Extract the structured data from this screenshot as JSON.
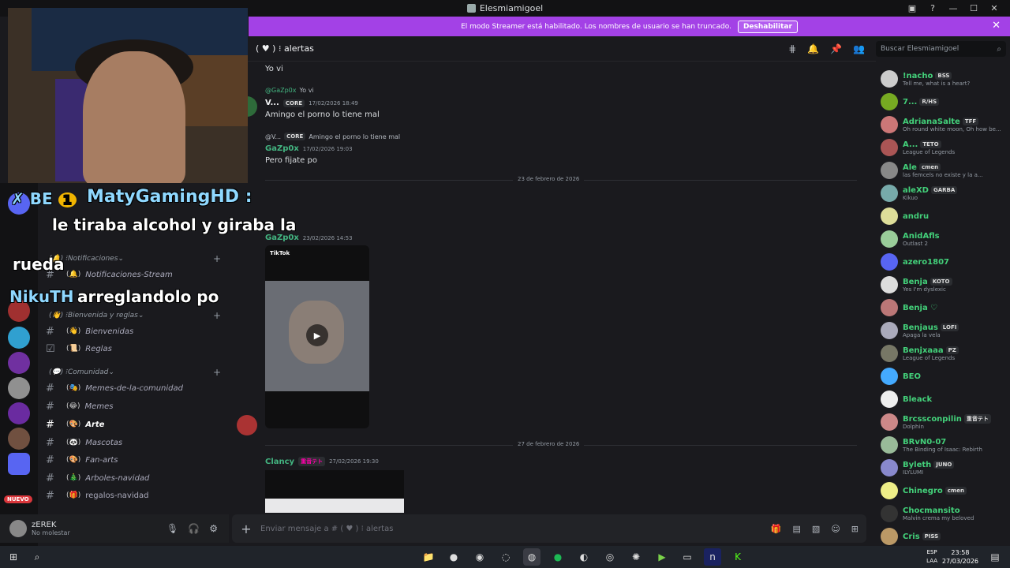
{
  "window": {
    "title": "Elesmiamigoel"
  },
  "banner": {
    "text": "El modo Streamer está habilitado. Los nombres de usuario se han truncado.",
    "button": "Deshabilitar"
  },
  "channel": {
    "name": "alertas",
    "emoji": "♥"
  },
  "search": {
    "placeholder": "Buscar Elesmiamigoel"
  },
  "messages": {
    "m0": "Yo vi",
    "r1_user": "@GaZp0x",
    "r1_text": "Yo vi",
    "a1_name": "V...",
    "a1_tag": "CORE",
    "a1_ts": "17/02/2026 18:49",
    "a1_text": "Amingo el porno lo tiene mal",
    "r2_user": "@V...",
    "r2_tag": "CORE",
    "r2_text": "Amingo el porno lo tiene mal",
    "a2_name": "GaZp0x",
    "a2_ts": "17/02/2026 19:03",
    "a2_text": "Pero fijate po",
    "div1": "23 de febrero de 2026",
    "a3_name": "GaZp0x",
    "a3_ts": "23/02/2026 14:53",
    "tiktok": "TikTok",
    "div2": "27 de febrero de 2026",
    "a4_name": "Clancy",
    "a4_tag": "重音テト",
    "a4_ts": "27/02/2026 19:30"
  },
  "composer": {
    "placeholder": "Enviar mensaje a #  (  ♥  )  ⁝ alertas"
  },
  "sidebar": {
    "cat_notif": "Notificaciones",
    "ch_notif_stream": "Notificaciones-Stream",
    "cat_bienvenida": "Bienvenida y reglas",
    "ch_bienvenidas": "Bienvenidas",
    "ch_reglas": "Reglas",
    "cat_comunidad": "Comunidad",
    "ch_memes_com": "Memes-de-la-comunidad",
    "ch_memes": "Memes",
    "ch_arte": "Arte",
    "ch_mascotas": "Mascotas",
    "ch_fanarts": "Fan-arts",
    "ch_arboles": "Arboles-navidad",
    "ch_regalos": "regalos-navidad",
    "nuevo": "NUEVO"
  },
  "user": {
    "name": "zEREK",
    "status": "No molestar"
  },
  "members": [
    {
      "name": "!nacho",
      "tag": "BSS",
      "sub": "Tell me, what is a heart?",
      "color": "#43d17a"
    },
    {
      "name": "7...",
      "tag": "R/HS",
      "sub": "",
      "color": "#43d17a"
    },
    {
      "name": "AdrianaSalte",
      "tag": "TFF",
      "sub": "Oh round white moon, Oh how be...",
      "color": "#43d17a"
    },
    {
      "name": "A...",
      "tag": "TETO",
      "sub": "League of Legends",
      "color": "#43d17a"
    },
    {
      "name": "Ale",
      "tag": "cmen",
      "sub": "las femcels no existe y la a...",
      "color": "#43d17a"
    },
    {
      "name": "aleXD",
      "tag": "GARBA",
      "sub": "Kikuo",
      "color": "#43d17a"
    },
    {
      "name": "andru",
      "tag": "",
      "sub": "",
      "color": "#43d17a"
    },
    {
      "name": "AnidAfls",
      "tag": "",
      "sub": "Outlast 2",
      "color": "#43d17a"
    },
    {
      "name": "azero1807",
      "tag": "",
      "sub": "",
      "color": "#43d17a"
    },
    {
      "name": "Benja",
      "tag": "KOTO",
      "sub": "Yes I'm dyslexic",
      "color": "#43d17a"
    },
    {
      "name": "Benja ♡",
      "tag": "",
      "sub": "",
      "color": "#43d17a"
    },
    {
      "name": "Benjaus",
      "tag": "LOFI",
      "sub": "Apaga la vela",
      "color": "#43d17a"
    },
    {
      "name": "Benjxaaa",
      "tag": "PZ",
      "sub": "League of Legends",
      "color": "#43d17a"
    },
    {
      "name": "BEO",
      "tag": "",
      "sub": "",
      "color": "#43d17a"
    },
    {
      "name": "Bleack",
      "tag": "",
      "sub": "",
      "color": "#43d17a"
    },
    {
      "name": "Brcssconpilin",
      "tag": "重音テト",
      "sub": "Dolphin",
      "color": "#43d17a"
    },
    {
      "name": "BRvN0-07",
      "tag": "",
      "sub": "The Binding of Isaac: Rebirth",
      "color": "#43d17a"
    },
    {
      "name": "Byleth",
      "tag": "JUNO",
      "sub": "ILYLUMI",
      "color": "#43d17a"
    },
    {
      "name": "Chinegro",
      "tag": "cmen",
      "sub": "",
      "color": "#43d17a"
    },
    {
      "name": "Chocmansito",
      "tag": "",
      "sub": "Malvin crema my beloved",
      "color": "#43d17a"
    },
    {
      "name": "Cris",
      "tag": "PISS",
      "sub": "",
      "color": "#43d17a"
    }
  ],
  "stream_overlay": {
    "donor": "MatyGamingHD :",
    "donor_rank": "1",
    "line1": "le tiraba alcohol y giraba la",
    "line2": "rueda",
    "donor2": "NikuTH :",
    "line3": "arreglandolo po"
  },
  "taskbar": {
    "lang1": "ESP",
    "lang2": "LAA",
    "time": "23:58",
    "date": "27/03/2026"
  }
}
